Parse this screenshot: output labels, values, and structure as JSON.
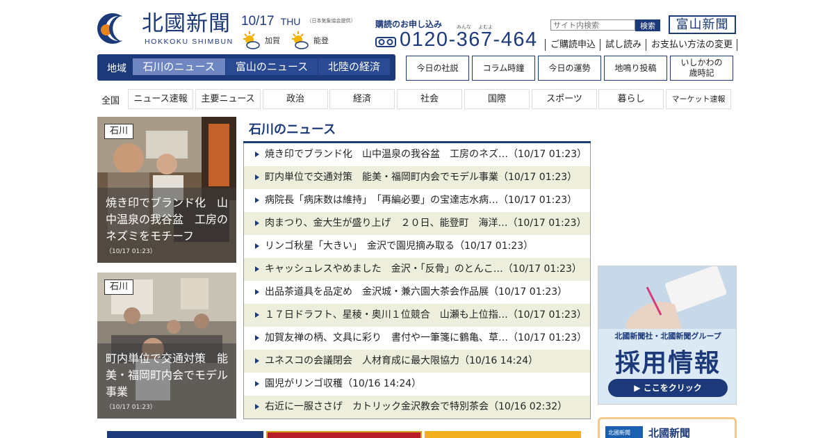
{
  "header": {
    "logo_jp": "北國新聞",
    "logo_en": "HOKKOKU SHIMBUN",
    "date": "10/17",
    "weekday": "THU",
    "weather_source": "（日本気象協会提供）",
    "weather": [
      {
        "area": "加賀",
        "icon": "sun-cloud-icon"
      },
      {
        "area": "能登",
        "icon": "sun-cloud-icon"
      }
    ],
    "subscribe_title": "購読のお申し込み",
    "subscribe_ruby": "みんな よむよ",
    "freedial_icon": "freedial-icon",
    "phone": "0120-367-464",
    "search_placeholder": "サイト内検索",
    "search_button": "検索",
    "toyama_logo": "富山新聞",
    "links": [
      "ご購読申込",
      "試し読み",
      "お支払い方法の変更"
    ]
  },
  "region_nav": {
    "label": "地域",
    "tabs": [
      "石川のニュース",
      "富山のニュース",
      "北陸の経済"
    ],
    "active": 0
  },
  "feature_buttons": [
    "今日の社説",
    "コラム時鐘",
    "今日の運勢",
    "地鳴り投稿",
    "いしかわの\n歳時記"
  ],
  "categories": {
    "all": "全国",
    "items": [
      "ニュース速報",
      "主要ニュース",
      "政治",
      "経済",
      "社会",
      "国際",
      "スポーツ",
      "暮らし",
      "マーケット速報"
    ]
  },
  "photo_cards": [
    {
      "tag": "石川",
      "title": "焼き印でブランド化　山中温泉の我谷盆　工房のネズミをモチーフ",
      "time": "（10/17 01:23）"
    },
    {
      "tag": "石川",
      "title": "町内単位で交通対策　能美・福岡町内会でモデル事業",
      "time": "（10/17 01:23）"
    }
  ],
  "news": {
    "heading": "石川のニュース",
    "items": [
      "焼き印でブランド化　山中温泉の我谷盆　工房のネズ…（10/17 01:23）",
      "町内単位で交通対策　能美・福岡町内会でモデル事業（10/17 01:23）",
      "病院長「病床数は維持」　「再編必要」の宝達志水病…（10/17 01:23）",
      "肉まつり、金大生が盛り上げ　２０日、能登町　海洋…（10/17 01:23）",
      "リンゴ秋星「大きい」　金沢で園児摘み取る（10/17 01:23）",
      "キャッシュレスやめました　金沢・「反骨」のとんこ…（10/17 01:23）",
      "出品茶道具を品定め　金沢城・兼六園大茶会作品展（10/17 01:23）",
      "１７日ドラフト、星稜・奥川１位競合　山瀬も上位指…（10/17 01:23）",
      "加賀友禅の柄、文具に彩り　書付や一筆箋に鶴亀、草…（10/17 01:23）",
      "ユネスコの会議閉会　人材育成に最大限協力（10/16 14:24）",
      "園児がリンゴ収穫（10/16 14:24）",
      "右近に一服ささげ　カトリック金沢教会で特別茶会（10/16 02:32）"
    ]
  },
  "recruit_ad": {
    "line1": "北國新聞社・北國新聞グループ",
    "line2": "採用情報",
    "button": "▶ ここをクリック"
  },
  "paper_box": {
    "name": "北國新聞",
    "thumb": "北國新聞"
  },
  "colors": {
    "brand": "#1c3a7a",
    "active_tab": "#6e86c2",
    "stripe": "#eeeedd",
    "logo_orange": "#e8831d"
  }
}
